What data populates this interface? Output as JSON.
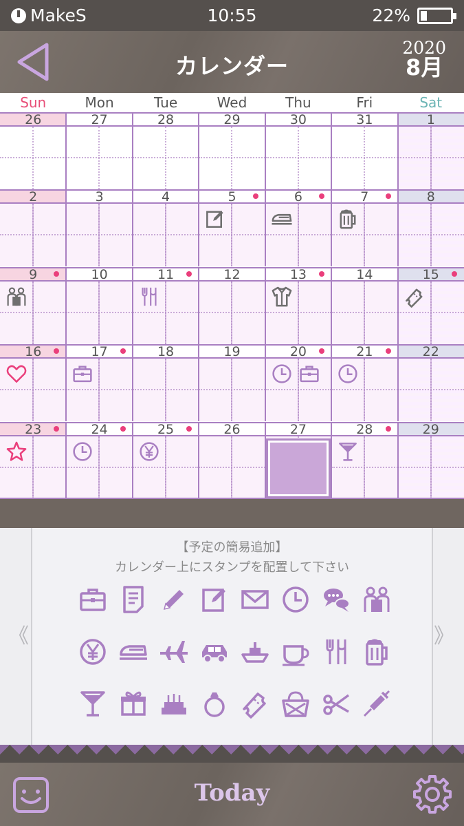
{
  "status_bar": {
    "carrier": "MakeS",
    "time": "10:55",
    "battery_percent": "22%",
    "battery_level": 0.22
  },
  "header": {
    "title": "カレンダー",
    "year": "2020",
    "month": "8月"
  },
  "calendar": {
    "weekdays": [
      "Sun",
      "Mon",
      "Tue",
      "Wed",
      "Thu",
      "Fri",
      "Sat"
    ],
    "weeks": [
      [
        {
          "day": "26",
          "dot": false,
          "stamps": [],
          "other_month": true
        },
        {
          "day": "27",
          "dot": false,
          "stamps": [],
          "other_month": true
        },
        {
          "day": "28",
          "dot": false,
          "stamps": [],
          "other_month": true
        },
        {
          "day": "29",
          "dot": false,
          "stamps": [],
          "other_month": true
        },
        {
          "day": "30",
          "dot": false,
          "stamps": [],
          "other_month": true
        },
        {
          "day": "31",
          "dot": false,
          "stamps": [],
          "other_month": true
        },
        {
          "day": "1",
          "dot": false,
          "stamps": [],
          "other_month": false
        }
      ],
      [
        {
          "day": "2",
          "dot": false,
          "stamps": []
        },
        {
          "day": "3",
          "dot": false,
          "stamps": []
        },
        {
          "day": "4",
          "dot": false,
          "stamps": []
        },
        {
          "day": "5",
          "dot": true,
          "stamps": [
            "memo-icon"
          ]
        },
        {
          "day": "6",
          "dot": true,
          "stamps": [
            "train-icon"
          ]
        },
        {
          "day": "7",
          "dot": true,
          "stamps": [
            "beer-icon"
          ]
        },
        {
          "day": "8",
          "dot": false,
          "stamps": []
        }
      ],
      [
        {
          "day": "9",
          "dot": true,
          "stamps": [
            "people-icon"
          ]
        },
        {
          "day": "10",
          "dot": false,
          "stamps": []
        },
        {
          "day": "11",
          "dot": true,
          "stamps": [
            "restaurant-icon"
          ]
        },
        {
          "day": "12",
          "dot": false,
          "stamps": []
        },
        {
          "day": "13",
          "dot": true,
          "stamps": [
            "shirt-icon"
          ]
        },
        {
          "day": "14",
          "dot": false,
          "stamps": []
        },
        {
          "day": "15",
          "dot": true,
          "stamps": [
            "ticket-icon"
          ]
        }
      ],
      [
        {
          "day": "16",
          "dot": true,
          "stamps": [
            "heart-icon"
          ]
        },
        {
          "day": "17",
          "dot": true,
          "stamps": [
            "briefcase-icon"
          ]
        },
        {
          "day": "18",
          "dot": false,
          "stamps": []
        },
        {
          "day": "19",
          "dot": false,
          "stamps": []
        },
        {
          "day": "20",
          "dot": true,
          "stamps": [
            "clock-icon",
            "briefcase-icon"
          ]
        },
        {
          "day": "21",
          "dot": true,
          "stamps": [
            "clock-icon"
          ]
        },
        {
          "day": "22",
          "dot": false,
          "stamps": []
        }
      ],
      [
        {
          "day": "23",
          "dot": true,
          "stamps": [
            "star-icon"
          ]
        },
        {
          "day": "24",
          "dot": true,
          "stamps": [
            "clock-icon"
          ]
        },
        {
          "day": "25",
          "dot": true,
          "stamps": [
            "yen-icon"
          ]
        },
        {
          "day": "26",
          "dot": false,
          "stamps": []
        },
        {
          "day": "27",
          "dot": false,
          "stamps": [],
          "selected": true
        },
        {
          "day": "28",
          "dot": true,
          "stamps": [
            "cocktail-icon"
          ]
        },
        {
          "day": "29",
          "dot": false,
          "stamps": []
        }
      ]
    ]
  },
  "stamp_panel": {
    "title": "【予定の簡易追加】",
    "subtitle": "カレンダー上にスタンプを配置して下さい",
    "prev_arrow": "《",
    "next_arrow": "》",
    "rows": [
      [
        "briefcase-icon",
        "document-icon",
        "pencil-icon",
        "memo-icon",
        "mail-icon",
        "clock-icon",
        "chat-icon",
        "people-icon"
      ],
      [
        "yen-icon",
        "train-icon",
        "airplane-icon",
        "car-icon",
        "ship-icon",
        "coffee-icon",
        "restaurant-icon",
        "beer-icon"
      ],
      [
        "cocktail-icon",
        "gift-icon",
        "cake-icon",
        "ring-icon",
        "ticket-icon",
        "basket-icon",
        "scissors-icon",
        "syringe-icon"
      ]
    ]
  },
  "bottom_bar": {
    "today_label": "Today"
  },
  "colors": {
    "accent": "#a97fc2",
    "dot": "#ea3f7c",
    "sun": "#e84f78",
    "sat": "#6bb4b4"
  }
}
